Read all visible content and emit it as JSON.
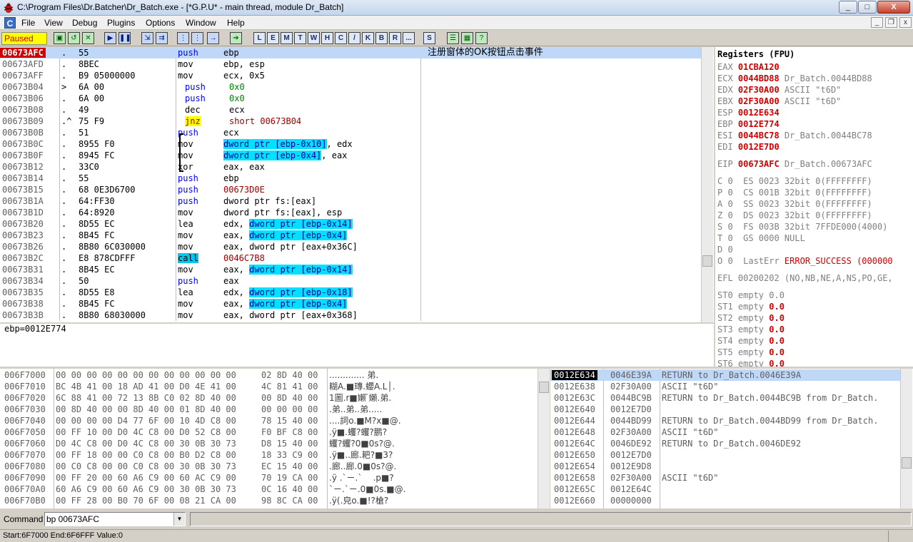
{
  "window": {
    "title": "C:\\Program Files\\Dr.Batcher\\Dr_Batch.exe - [*G.P.U* - main thread, module Dr_Batch]",
    "min": "_",
    "max": "□",
    "close": "X"
  },
  "menu": [
    "File",
    "View",
    "Debug",
    "Plugins",
    "Options",
    "Window",
    "Help"
  ],
  "toolbar": {
    "status": "Paused",
    "letter_buttons": [
      "L",
      "E",
      "M",
      "T",
      "W",
      "H",
      "C",
      "/",
      "K",
      "B",
      "R",
      "...",
      "S"
    ]
  },
  "cpu": {
    "comment": "注册窗体的OK按钮点击事件",
    "rows": [
      {
        "addr": "00673AFC",
        "mark": ".",
        "hex": "55",
        "ins": "push",
        "arg": "ebp"
      },
      {
        "addr": "00673AFD",
        "mark": ".",
        "hex": "8BEC",
        "ins": "mov",
        "arg": "ebp, esp"
      },
      {
        "addr": "00673AFF",
        "mark": ".",
        "hex": "B9 05000000",
        "ins": "mov",
        "arg": "ecx, 0x5"
      },
      {
        "addr": "00673B04",
        "mark": ">",
        "hex": "6A 00",
        "ins": "push",
        "arg": "0x0"
      },
      {
        "addr": "00673B06",
        "mark": ".",
        "hex": "6A 00",
        "ins": "push",
        "arg": "0x0"
      },
      {
        "addr": "00673B08",
        "mark": ".",
        "hex": "49",
        "ins": "dec",
        "arg": "ecx"
      },
      {
        "addr": "00673B09",
        "mark": ".^",
        "hex": "75 F9",
        "ins": "jnz",
        "arg": "short 00673B04"
      },
      {
        "addr": "00673B0B",
        "mark": ".",
        "hex": "51",
        "ins": "push",
        "arg": "ecx"
      },
      {
        "addr": "00673B0C",
        "mark": ".",
        "hex": "8955 F0",
        "ins": "mov",
        "arg_mem": "dword ptr [ebp-0x10]",
        "arg": ", edx"
      },
      {
        "addr": "00673B0F",
        "mark": ".",
        "hex": "8945 FC",
        "ins": "mov",
        "arg_mem": "dword ptr [ebp-0x4]",
        "arg": ", eax"
      },
      {
        "addr": "00673B12",
        "mark": ".",
        "hex": "33C0",
        "ins": "xor",
        "arg": "eax, eax"
      },
      {
        "addr": "00673B14",
        "mark": ".",
        "hex": "55",
        "ins": "push",
        "arg": "ebp"
      },
      {
        "addr": "00673B15",
        "mark": ".",
        "hex": "68 0E3D6700",
        "ins": "push",
        "arg": "00673D0E"
      },
      {
        "addr": "00673B1A",
        "mark": ".",
        "hex": "64:FF30",
        "ins": "push",
        "arg": "dword ptr fs:[eax]"
      },
      {
        "addr": "00673B1D",
        "mark": ".",
        "hex": "64:8920",
        "ins": "mov",
        "arg": "dword ptr fs:[eax], esp"
      },
      {
        "addr": "00673B20",
        "mark": ".",
        "hex": "8D55 EC",
        "ins": "lea",
        "arg_pre": "edx, ",
        "arg_mem": "dword ptr [ebp-0x14]"
      },
      {
        "addr": "00673B23",
        "mark": ".",
        "hex": "8B45 FC",
        "ins": "mov",
        "arg_pre": "eax, ",
        "arg_mem": "dword ptr [ebp-0x4]"
      },
      {
        "addr": "00673B26",
        "mark": ".",
        "hex": "8B80 6C030000",
        "ins": "mov",
        "arg": "eax, dword ptr [eax+0x36C]"
      },
      {
        "addr": "00673B2C",
        "mark": ".",
        "hex": "E8 878CDFFF",
        "ins": "call",
        "arg": "0046C7B8"
      },
      {
        "addr": "00673B31",
        "mark": ".",
        "hex": "8B45 EC",
        "ins": "mov",
        "arg_pre": "eax, ",
        "arg_mem": "dword ptr [ebp-0x14]"
      },
      {
        "addr": "00673B34",
        "mark": ".",
        "hex": "50",
        "ins": "push",
        "arg": "eax"
      },
      {
        "addr": "00673B35",
        "mark": ".",
        "hex": "8D55 E8",
        "ins": "lea",
        "arg_pre": "edx, ",
        "arg_mem": "dword ptr [ebp-0x18]"
      },
      {
        "addr": "00673B38",
        "mark": ".",
        "hex": "8B45 FC",
        "ins": "mov",
        "arg_pre": "eax, ",
        "arg_mem": "dword ptr [ebp-0x4]"
      },
      {
        "addr": "00673B3B",
        "mark": ".",
        "hex": "8B80 68030000",
        "ins": "mov",
        "arg": "eax, dword ptr [eax+0x368]"
      }
    ]
  },
  "info": "ebp=0012E774",
  "registers": {
    "title": "Registers (FPU)",
    "gp": [
      {
        "n": "EAX",
        "v": "01CBA120",
        "c": ""
      },
      {
        "n": "ECX",
        "v": "0044BD88",
        "c": "Dr_Batch.0044BD88"
      },
      {
        "n": "EDX",
        "v": "02F30A00",
        "c": "ASCII \"t6D\""
      },
      {
        "n": "EBX",
        "v": "02F30A00",
        "c": "ASCII \"t6D\""
      },
      {
        "n": "ESP",
        "v": "0012E634",
        "c": ""
      },
      {
        "n": "EBP",
        "v": "0012E774",
        "c": ""
      },
      {
        "n": "ESI",
        "v": "0044BC78",
        "c": "Dr_Batch.0044BC78"
      },
      {
        "n": "EDI",
        "v": "0012E7D0",
        "c": ""
      }
    ],
    "eip": {
      "n": "EIP",
      "v": "00673AFC",
      "c": "Dr_Batch.00673AFC"
    },
    "flags": [
      "C 0  ES 0023 32bit 0(FFFFFFFF)",
      "P 0  CS 001B 32bit 0(FFFFFFFF)",
      "A 0  SS 0023 32bit 0(FFFFFFFF)",
      "Z 0  DS 0023 32bit 0(FFFFFFFF)",
      "S 0  FS 003B 32bit 7FFDE000(4000)",
      "T 0  GS 0000 NULL",
      "D 0"
    ],
    "lasterr": {
      "pre": "O 0  LastErr ",
      "v": "ERROR_SUCCESS (000000"
    },
    "efl": "EFL 00200202 (NO,NB,NE,A,NS,PO,GE,",
    "st": [
      "ST0 empty 0.0",
      "ST1 empty",
      "ST2 empty",
      "ST3 empty",
      "ST4 empty",
      "ST5 empty",
      "ST6 empty"
    ],
    "st_red": [
      "",
      "0.0",
      "0.0",
      "0.0",
      "0.0",
      "0.0",
      "0.0"
    ]
  },
  "dump": [
    {
      "a": "006F7000",
      "h": "00 00 00 00 00 00 00 00 00 00 00 00 02 8D 40 00",
      "t": "............. 弟."
    },
    {
      "a": "006F7010",
      "h": "BC 4B 41 00 18 AD 41 00 D0 4E 41 00 4C 81 41 00",
      "t": "糊A.■瑼.蠳A.L│."
    },
    {
      "a": "006F7020",
      "h": "6C 88 41 00 72 13 8B C0 02 8D 40 00 00 8D 40 00",
      "t": "1圖.r■嬾 ̄嬾.弟."
    },
    {
      "a": "006F7030",
      "h": "00 8D 40 00 00 8D 40 00 01 8D 40 00 00 00 00 00",
      "t": ".弟..弟..弟....."
    },
    {
      "a": "006F7040",
      "h": "00 00 00 00 D4 77 6F 00 10 4D C8 00 78 15 40 00",
      "t": "....詞o.■M?x■@."
    },
    {
      "a": "006F7050",
      "h": "00 FF 10 00 D0 4C C8 00 D0 52 C8 00 F0 BF C8 00",
      "t": ".ÿ■.蠼?蠼?鹏?"
    },
    {
      "a": "006F7060",
      "h": "D0 4C C8 00 D0 4C C8 00 30 0B 30 73 D8 15 40 00",
      "t": "蠼?蠼?0■0s?@."
    },
    {
      "a": "006F7070",
      "h": "00 FF 18 00 00 C0 C8 00 B0 D2 C8 00 18 33 C9 00",
      "t": ".ÿ■..廊.耙?■3?"
    },
    {
      "a": "006F7080",
      "h": "00 C0 C8 00 00 C0 C8 00 30 0B 30 73 EC 15 40 00",
      "t": ".廊..廊.0■0s?@."
    },
    {
      "a": "006F7090",
      "h": "00 FF 20 00 60 A6 C9 00 60 AC C9 00 70 19 CA 00",
      "t": ".ÿ .`ㄧ.`    .p■?"
    },
    {
      "a": "006F70A0",
      "h": "60 A6 C9 00 60 A6 C9 00 30 0B 30 73 0C 16 40 00",
      "t": "`ㄧ.`ㄧ.0■0s.■@."
    },
    {
      "a": "006F70B0",
      "h": "00 FF 28 00 B0 70 6F 00 08 21 CA 00 98 8C CA 00",
      "t": ".ÿ(.皃o.■!?槍?"
    }
  ],
  "stack": [
    {
      "a": "0012E634",
      "v": "0046E39A",
      "c": "RETURN to Dr_Batch.0046E39A"
    },
    {
      "a": "0012E638",
      "v": "02F30A00",
      "c": "ASCII \"t6D\""
    },
    {
      "a": "0012E63C",
      "v": "0044BC9B",
      "c": "RETURN to Dr_Batch.0044BC9B from Dr_Batch."
    },
    {
      "a": "0012E640",
      "v": "0012E7D0",
      "c": ""
    },
    {
      "a": "0012E644",
      "v": "0044BD99",
      "c": "RETURN to Dr_Batch.0044BD99 from Dr_Batch."
    },
    {
      "a": "0012E648",
      "v": "02F30A00",
      "c": "ASCII \"t6D\""
    },
    {
      "a": "0012E64C",
      "v": "0046DE92",
      "c": "RETURN to Dr_Batch.0046DE92"
    },
    {
      "a": "0012E650",
      "v": "0012E7D0",
      "c": ""
    },
    {
      "a": "0012E654",
      "v": "0012E9D8",
      "c": ""
    },
    {
      "a": "0012E658",
      "v": "02F30A00",
      "c": "ASCII \"t6D\""
    },
    {
      "a": "0012E65C",
      "v": "0012E64C",
      "c": ""
    },
    {
      "a": "0012E660",
      "v": "00000000",
      "c": ""
    }
  ],
  "command": {
    "label": "Command",
    "value": "bp 00673AFC"
  },
  "statusbar": "Start:6F7000 End:6F6FFF Value:0"
}
